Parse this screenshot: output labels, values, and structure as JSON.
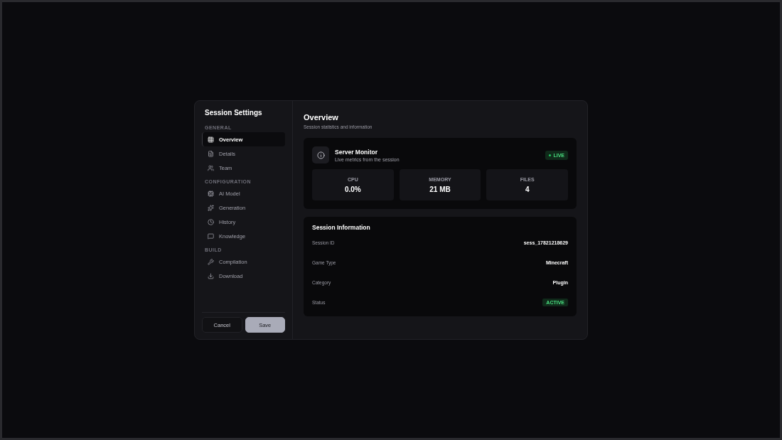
{
  "dialog": {
    "title": "Session Settings",
    "sidebar": {
      "sections": [
        {
          "heading": "GENERAL",
          "items": [
            {
              "label": "Overview",
              "selected": true
            },
            {
              "label": "Details",
              "selected": false
            },
            {
              "label": "Team",
              "selected": false
            }
          ]
        },
        {
          "heading": "CONFIGURATION",
          "items": [
            {
              "label": "AI Model",
              "selected": false
            },
            {
              "label": "Generation",
              "selected": false
            },
            {
              "label": "History",
              "selected": false
            },
            {
              "label": "Knowledge",
              "selected": false
            }
          ]
        },
        {
          "heading": "BUILD",
          "items": [
            {
              "label": "Compilation",
              "selected": false
            },
            {
              "label": "Download",
              "selected": false
            }
          ]
        }
      ]
    },
    "buttons": [
      {
        "label": "Cancel",
        "kind": "secondary"
      },
      {
        "label": "Save",
        "kind": "primary"
      }
    ],
    "content": {
      "title": "Overview",
      "subtitle": "Session statistics and information",
      "monitor": {
        "title": "Server Monitor",
        "subtitle": "Live metrics from the session",
        "badge": "LIVE",
        "live": true,
        "metrics": [
          {
            "label": "CPU",
            "value": "0.0%"
          },
          {
            "label": "MEMORY",
            "value": "21 MB"
          },
          {
            "label": "FILES",
            "value": "4"
          }
        ]
      },
      "info": {
        "title": "Session Information",
        "rows": [
          {
            "label": "Session ID",
            "value": "sess_17821218629",
            "kind": "text"
          },
          {
            "label": "Game Type",
            "value": "Minecraft",
            "kind": "text"
          },
          {
            "label": "Category",
            "value": "Plugin",
            "kind": "text"
          },
          {
            "label": "Status",
            "value": "ACTIVE",
            "kind": "badge"
          }
        ]
      }
    }
  }
}
